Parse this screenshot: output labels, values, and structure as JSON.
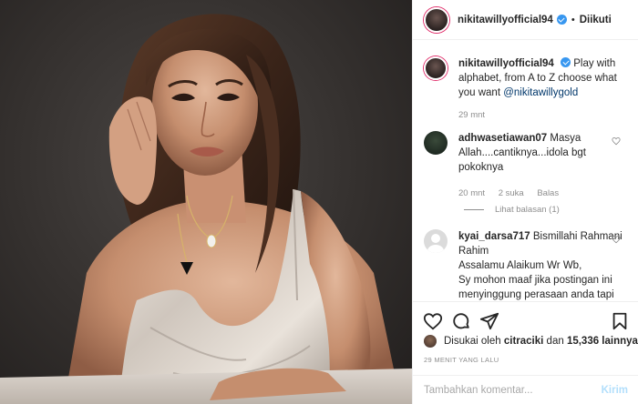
{
  "header": {
    "username": "nikitawillyofficial94",
    "separator": "•",
    "follow_label": "Diikuti"
  },
  "caption": {
    "username": "nikitawillyofficial94",
    "text": "Play with alphabet, from A to Z choose what you want",
    "mention": "@nikitawillygold",
    "time": "29 mnt"
  },
  "comments": [
    {
      "username": "adhwasetiawan07",
      "text": "Masya Allah....cantiknya...idola bgt pokoknya",
      "time": "20 mnt",
      "likes": "2 suka",
      "reply_label": "Balas",
      "view_replies": "Lihat balasan (1)"
    },
    {
      "username": "kyai_darsa717",
      "line1": "Bismillahi Rahmani Rahim",
      "line2": "Assalamu Alaikum Wr Wb,",
      "line3": "Sy mohon maaf jika postingan ini menyinggung perasaan anda tapi ini kisah nyata sya pribadi ingin"
    }
  ],
  "likes": {
    "prefix": "Disukai oleh",
    "user": "citraciki",
    "conj": "dan",
    "count": "15,336 lainnya"
  },
  "timestamp": "29 MENIT YANG LALU",
  "add_comment": {
    "placeholder": "Tambahkan komentar...",
    "post_label": "Kirim"
  },
  "icons": [
    "heart-icon",
    "comment-icon",
    "share-icon",
    "bookmark-icon",
    "verified-icon"
  ],
  "colors": {
    "verified": "#3897f0",
    "post_button_disabled": "#b2dffc",
    "muted_text": "#8e8e8e",
    "divider": "#efefef",
    "story_ring": "#e1306c"
  }
}
